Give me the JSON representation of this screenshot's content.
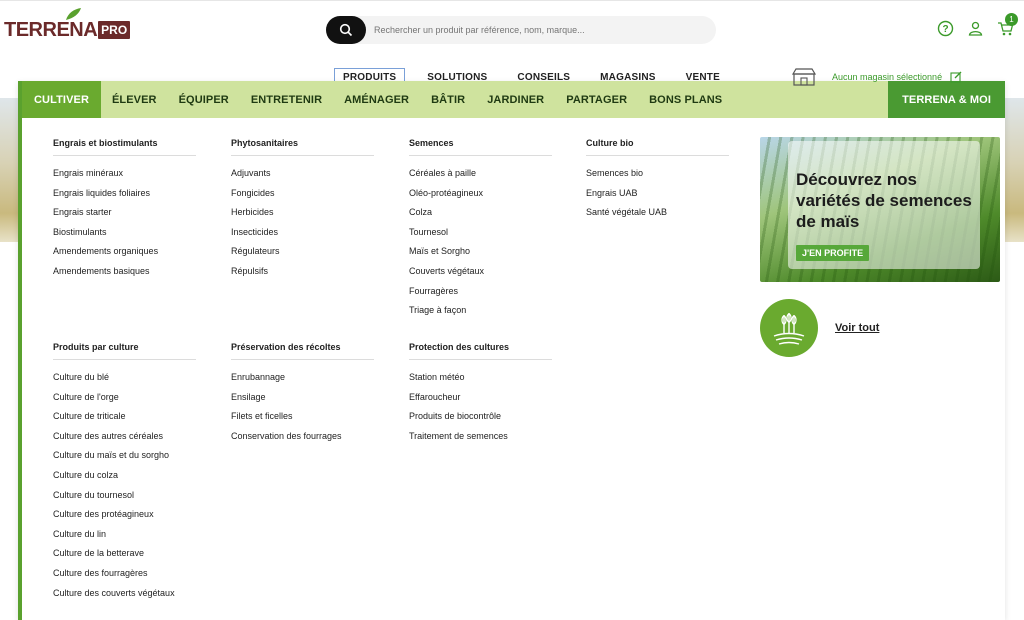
{
  "logo": {
    "text": "TERRENA",
    "badge": "PRO"
  },
  "search": {
    "placeholder": "Rechercher un produit par référence, nom, marque..."
  },
  "header_icons": {
    "cart_count": "1"
  },
  "subnav": [
    {
      "label": "PRODUITS",
      "active": true
    },
    {
      "label": "SOLUTIONS"
    },
    {
      "label": "CONSEILS"
    },
    {
      "label": "MAGASINS"
    },
    {
      "label": "VENTE"
    }
  ],
  "store": {
    "label": "Aucun magasin sélectionné"
  },
  "categories": [
    "CULTIVER",
    "ÉLEVER",
    "ÉQUIPER",
    "ENTRETENIR",
    "AMÉNAGER",
    "BÂTIR",
    "JARDINER",
    "PARTAGER",
    "BONS PLANS",
    "TERRENA & MOI"
  ],
  "columns": [
    {
      "title": "Engrais et biostimulants",
      "items": [
        "Engrais minéraux",
        "Engrais liquides foliaires",
        "Engrais starter",
        "Biostimulants",
        "Amendements organiques",
        "Amendements basiques"
      ]
    },
    {
      "title": "Phytosanitaires",
      "items": [
        "Adjuvants",
        "Fongicides",
        "Herbicides",
        "Insecticides",
        "Régulateurs",
        "Répulsifs"
      ]
    },
    {
      "title": "Semences",
      "items": [
        "Céréales à paille",
        "Oléo-protéagineux",
        "Colza",
        "Tournesol",
        "Maïs et Sorgho",
        "Couverts végétaux",
        "Fourragères",
        "Triage à façon"
      ]
    },
    {
      "title": "Culture bio",
      "items": [
        "Semences bio",
        "Engrais UAB",
        "Santé végétale UAB"
      ]
    },
    {
      "title": "Produits par culture",
      "items": [
        "Culture du blé",
        "Culture de l'orge",
        "Culture de triticale",
        "Culture des autres céréales",
        "Culture du maïs et du sorgho",
        "Culture du colza",
        "Culture du tournesol",
        "Culture des protéagineux",
        "Culture du lin",
        "Culture de la betterave",
        "Culture des fourragères",
        "Culture des couverts végétaux"
      ]
    },
    {
      "title": "Préservation des récoltes",
      "items": [
        "Enrubannage",
        "Ensilage",
        "Filets et ficelles",
        "Conservation des fourrages"
      ]
    },
    {
      "title": "Protection des cultures",
      "items": [
        "Station météo",
        "Effaroucheur",
        "Produits de biocontrôle",
        "Traitement de semences"
      ]
    }
  ],
  "promo": {
    "text": "Découvrez nos variétés de semences de maïs",
    "button": "J'EN PROFITE"
  },
  "voir_tout": {
    "label": "Voir tout"
  },
  "colors": {
    "accent_green": "#6aaa2f",
    "catbar": "#cfe39e",
    "brand": "#6b2a2a"
  }
}
